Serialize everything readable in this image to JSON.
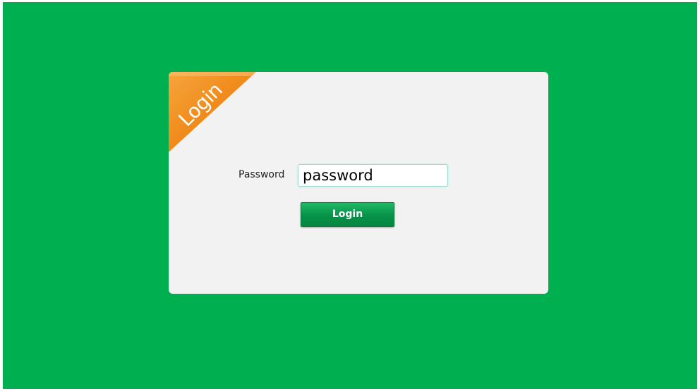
{
  "colors": {
    "background": "#00b050",
    "card": "#f2f2f2",
    "ribbon": "#f08a1a",
    "button": "#07924a"
  },
  "ribbon": {
    "label": "Login"
  },
  "form": {
    "password_label": "Password",
    "password_value": "password",
    "submit_label": "Login"
  }
}
